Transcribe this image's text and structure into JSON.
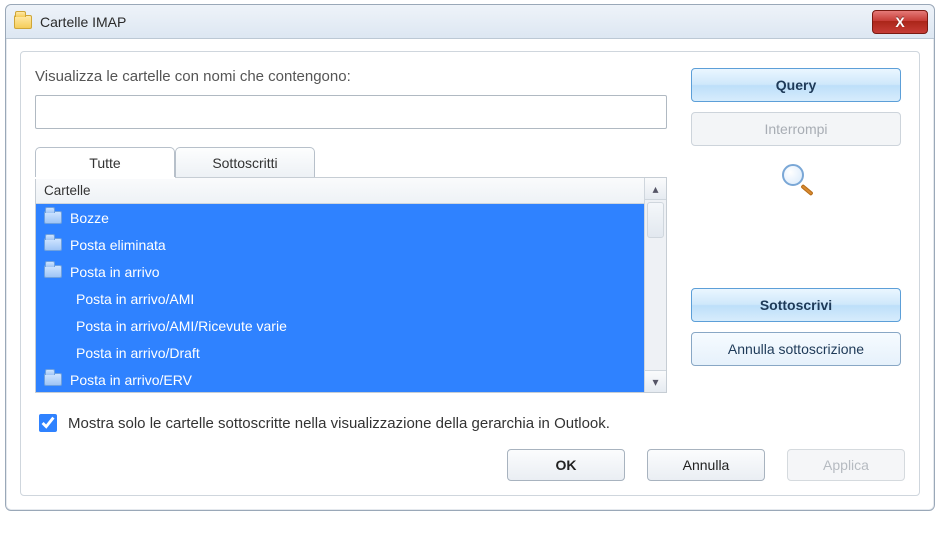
{
  "window": {
    "title": "Cartelle IMAP",
    "close_label": "X"
  },
  "search": {
    "label": "Visualizza le cartelle con nomi che contengono:",
    "value": ""
  },
  "tabs": {
    "all": "Tutte",
    "subscribed": "Sottoscritti"
  },
  "list": {
    "header": "Cartelle",
    "items": [
      {
        "name": "Bozze",
        "hasIcon": true
      },
      {
        "name": "Posta eliminata",
        "hasIcon": true
      },
      {
        "name": "Posta in arrivo",
        "hasIcon": true
      },
      {
        "name": "Posta in arrivo/AMI",
        "hasIcon": false
      },
      {
        "name": "Posta in arrivo/AMI/Ricevute varie",
        "hasIcon": false
      },
      {
        "name": "Posta in arrivo/Draft",
        "hasIcon": false
      },
      {
        "name": "Posta in arrivo/ERV",
        "hasIcon": true
      }
    ]
  },
  "side": {
    "query": "Query",
    "stop": "Interrompi",
    "subscribe": "Sottoscrivi",
    "unsubscribe": "Annulla sottoscrizione"
  },
  "checkbox": {
    "checked": true,
    "label": "Mostra solo le cartelle sottoscritte nella visualizzazione della gerarchia in Outlook."
  },
  "footer": {
    "ok": "OK",
    "cancel": "Annulla",
    "apply": "Applica"
  }
}
